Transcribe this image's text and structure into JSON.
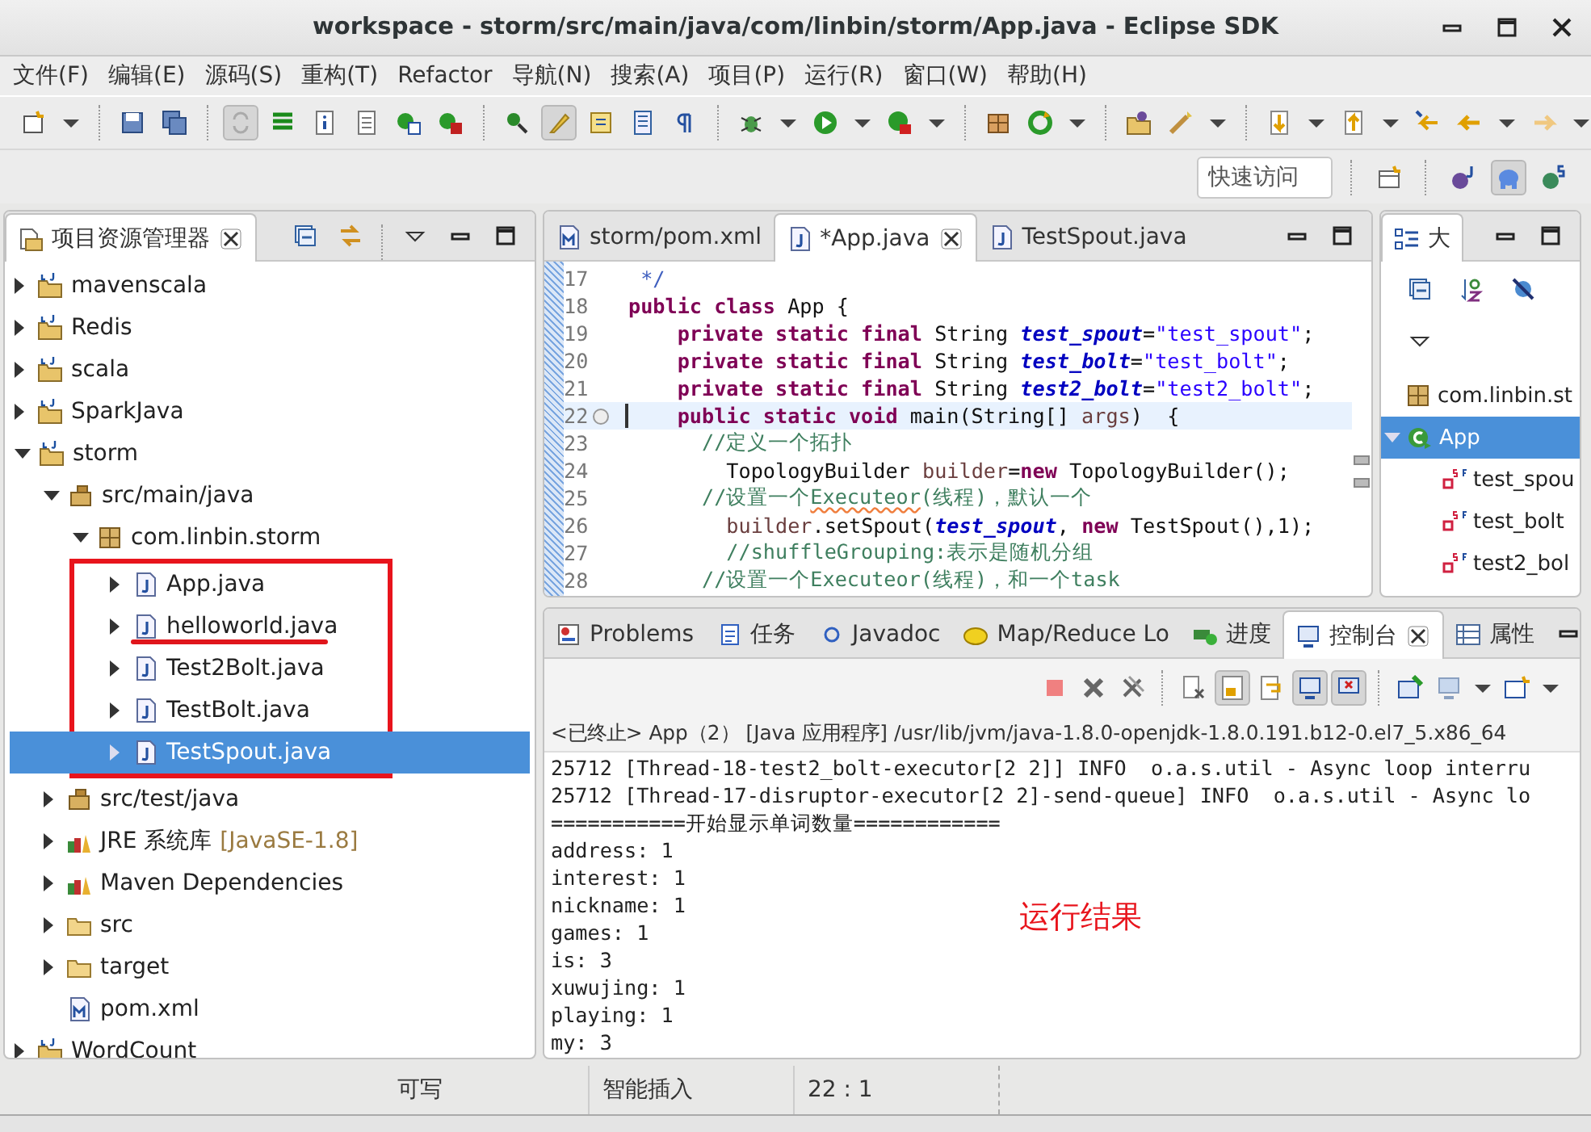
{
  "window": {
    "title": "workspace - storm/src/main/java/com/linbin/storm/App.java - Eclipse SDK"
  },
  "menu": [
    "文件(F)",
    "编辑(E)",
    "源码(S)",
    "重构(T)",
    "Refactor",
    "导航(N)",
    "搜索(A)",
    "项目(P)",
    "运行(R)",
    "窗口(W)",
    "帮助(H)"
  ],
  "quick_access": {
    "placeholder": "快速访问"
  },
  "explorer": {
    "title": "项目资源管理器",
    "items": [
      {
        "label": "mavenscala",
        "kind": "project",
        "expanded": false,
        "selected": false
      },
      {
        "label": "Redis",
        "kind": "project",
        "expanded": false,
        "selected": false
      },
      {
        "label": "scala",
        "kind": "project",
        "expanded": false,
        "selected": false
      },
      {
        "label": "SparkJava",
        "kind": "project",
        "expanded": false,
        "selected": false
      },
      {
        "label": "storm",
        "kind": "project",
        "expanded": true,
        "selected": false,
        "children": [
          {
            "label": "src/main/java",
            "kind": "source",
            "expanded": true,
            "selected": false,
            "children": [
              {
                "label": "com.linbin.storm",
                "kind": "package",
                "expanded": true,
                "selected": false,
                "children": [
                  {
                    "label": "App.java",
                    "kind": "java",
                    "expanded": false,
                    "selected": false,
                    "marked": true,
                    "struck": false
                  },
                  {
                    "label": "helloworld.java",
                    "kind": "java",
                    "expanded": false,
                    "selected": false,
                    "marked": true,
                    "struck": true
                  },
                  {
                    "label": "Test2Bolt.java",
                    "kind": "java",
                    "expanded": false,
                    "selected": false,
                    "marked": true,
                    "struck": false
                  },
                  {
                    "label": "TestBolt.java",
                    "kind": "java",
                    "expanded": false,
                    "selected": false,
                    "marked": true,
                    "struck": false
                  },
                  {
                    "label": "TestSpout.java",
                    "kind": "java",
                    "expanded": false,
                    "selected": true,
                    "marked": true,
                    "struck": false
                  }
                ]
              }
            ]
          },
          {
            "label": "src/test/java",
            "kind": "source",
            "expanded": false,
            "selected": false
          },
          {
            "label": "JRE 系统库",
            "decoration": "[JavaSE-1.8]",
            "kind": "library",
            "expanded": false,
            "selected": false
          },
          {
            "label": "Maven Dependencies",
            "kind": "library",
            "expanded": false,
            "selected": false
          },
          {
            "label": "src",
            "kind": "folder",
            "expanded": false,
            "selected": false
          },
          {
            "label": "target",
            "kind": "folder",
            "expanded": false,
            "selected": false
          },
          {
            "label": "pom.xml",
            "kind": "xml",
            "expanded": false,
            "selected": false
          }
        ]
      },
      {
        "label": "WordCount",
        "kind": "project",
        "expanded": false,
        "selected": false
      }
    ]
  },
  "editor": {
    "tabs": [
      {
        "label": "storm/pom.xml",
        "kind": "xml",
        "selected": false
      },
      {
        "label": "*App.java",
        "kind": "java",
        "selected": true
      },
      {
        "label": "TestSpout.java",
        "kind": "java",
        "selected": false
      }
    ],
    "lines": [
      {
        "number": "17",
        "current": false,
        "tokens": [
          {
            "kind": "doc",
            "text": " */"
          }
        ]
      },
      {
        "number": "18",
        "current": false,
        "tokens": [
          {
            "kind": "kw",
            "text": "public class"
          },
          {
            "kind": "plain",
            "text": " App {"
          }
        ]
      },
      {
        "number": "19",
        "current": false,
        "tokens": [
          {
            "kind": "kw",
            "text": "    private static final"
          },
          {
            "kind": "plain",
            "text": " String "
          },
          {
            "kind": "field",
            "text": "test_spout"
          },
          {
            "kind": "plain",
            "text": "="
          },
          {
            "kind": "str",
            "text": "\"test_spout\""
          },
          {
            "kind": "plain",
            "text": ";"
          }
        ]
      },
      {
        "number": "20",
        "current": false,
        "tokens": [
          {
            "kind": "kw",
            "text": "    private static final"
          },
          {
            "kind": "plain",
            "text": " String "
          },
          {
            "kind": "field",
            "text": "test_bolt"
          },
          {
            "kind": "plain",
            "text": "="
          },
          {
            "kind": "str",
            "text": "\"test_bolt\""
          },
          {
            "kind": "plain",
            "text": ";"
          }
        ]
      },
      {
        "number": "21",
        "current": false,
        "tokens": [
          {
            "kind": "kw",
            "text": "    private static final"
          },
          {
            "kind": "plain",
            "text": " String "
          },
          {
            "kind": "field",
            "text": "test2_bolt"
          },
          {
            "kind": "plain",
            "text": "="
          },
          {
            "kind": "str",
            "text": "\"test2_bolt\""
          },
          {
            "kind": "plain",
            "text": ";"
          }
        ]
      },
      {
        "number": "22",
        "current": true,
        "tokens": [
          {
            "kind": "kw",
            "text": "    public static void"
          },
          {
            "kind": "plain",
            "text": " main(String[] "
          },
          {
            "kind": "var",
            "text": "args"
          },
          {
            "kind": "plain",
            "text": ")  {"
          }
        ]
      },
      {
        "number": "23",
        "current": false,
        "tokens": [
          {
            "kind": "comment",
            "text": "      //定义一个拓扑"
          }
        ]
      },
      {
        "number": "24",
        "current": false,
        "tokens": [
          {
            "kind": "plain",
            "text": "        TopologyBuilder "
          },
          {
            "kind": "var",
            "text": "builder"
          },
          {
            "kind": "plain",
            "text": "="
          },
          {
            "kind": "kw",
            "text": "new"
          },
          {
            "kind": "plain",
            "text": " TopologyBuilder();"
          }
        ]
      },
      {
        "number": "25",
        "current": false,
        "tokens": [
          {
            "kind": "comment",
            "text": "      //设置一个"
          },
          {
            "kind": "typo",
            "text": "Executeor"
          },
          {
            "kind": "comment",
            "text": "(线程)，默认一个"
          }
        ]
      },
      {
        "number": "26",
        "current": false,
        "tokens": [
          {
            "kind": "var",
            "text": "        builder"
          },
          {
            "kind": "plain",
            "text": ".setSpout("
          },
          {
            "kind": "field",
            "text": "test_spout"
          },
          {
            "kind": "plain",
            "text": ", "
          },
          {
            "kind": "kw",
            "text": "new"
          },
          {
            "kind": "plain",
            "text": " TestSpout(),1);"
          }
        ]
      },
      {
        "number": "27",
        "current": false,
        "tokens": [
          {
            "kind": "comment",
            "text": "        //shuffleGrouping:表示是随机分组"
          }
        ]
      },
      {
        "number": "28",
        "current": false,
        "tokens": [
          {
            "kind": "comment",
            "text": "      //设置一个Executeor(线程)，和一个task"
          }
        ]
      }
    ]
  },
  "outline": {
    "title": "大",
    "items": [
      {
        "label": "com.linbin.st",
        "kind": "package",
        "expanded": false,
        "selected": false
      },
      {
        "label": "App",
        "kind": "class",
        "expanded": true,
        "selected": true,
        "children": [
          {
            "label": "test_spou",
            "kind": "field",
            "expanded": false,
            "selected": false
          },
          {
            "label": "test_bolt",
            "kind": "field",
            "expanded": false,
            "selected": false
          },
          {
            "label": "test2_bol",
            "kind": "field",
            "expanded": false,
            "selected": false
          }
        ]
      }
    ]
  },
  "console": {
    "tabs": [
      {
        "label": "Problems",
        "kind": "problems",
        "selected": false
      },
      {
        "label": "任务",
        "kind": "tasks",
        "selected": false
      },
      {
        "label": "Javadoc",
        "kind": "javadoc",
        "selected": false
      },
      {
        "label": "Map/Reduce Lo",
        "kind": "mapreduce",
        "selected": false
      },
      {
        "label": "进度",
        "kind": "progress",
        "selected": false
      },
      {
        "label": "控制台",
        "kind": "console",
        "selected": true
      },
      {
        "label": "属性",
        "kind": "properties",
        "selected": false
      }
    ],
    "header": "<已终止> App（2） [Java 应用程序] /usr/lib/jvm/java-1.8.0-openjdk-1.8.0.191.b12-0.el7_5.x86_64",
    "lines": [
      "25712 [Thread-18-test2_bolt-executor[2 2]] INFO  o.a.s.util - Async loop interru",
      "25712 [Thread-17-disruptor-executor[2 2]-send-queue] INFO  o.a.s.util - Async lo",
      "===========开始显示单词数量============",
      "address: 1",
      "interest: 1",
      "nickname: 1",
      "games: 1",
      "is: 3",
      "xuwujing: 1",
      "playing: 1",
      "my: 3"
    ],
    "annotation": "运行结果"
  },
  "status_bar": [
    "可写",
    "智能插入",
    "22 : 1"
  ]
}
